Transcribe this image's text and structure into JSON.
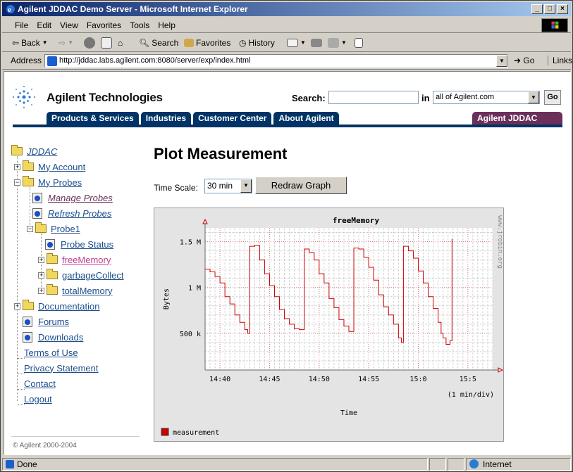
{
  "window": {
    "title": "Agilent JDDAC Demo Server - Microsoft Internet Explorer"
  },
  "menu": [
    "File",
    "Edit",
    "View",
    "Favorites",
    "Tools",
    "Help"
  ],
  "toolbar": {
    "back": "Back",
    "search": "Search",
    "favorites": "Favorites",
    "history": "History"
  },
  "address": {
    "label": "Address",
    "url": "http://jddac.labs.agilent.com:8080/server/exp/index.html",
    "go": "Go",
    "links": "Links"
  },
  "header": {
    "brand": "Agilent Technologies",
    "search_label": "Search:",
    "in_label": "in",
    "scope": "all of Agilent.com",
    "go": "Go",
    "tabs": [
      "Products & Services",
      "Industries",
      "Customer Center",
      "About Agilent"
    ],
    "home_tab": "Agilent JDDAC Home"
  },
  "sidebar": {
    "items": [
      {
        "label": "JDDAC"
      },
      {
        "label": "My Account"
      },
      {
        "label": "My Probes"
      },
      {
        "label": "Manage Probes"
      },
      {
        "label": "Refresh Probes"
      },
      {
        "label": "Probe1"
      },
      {
        "label": "Probe Status"
      },
      {
        "label": "freeMemory"
      },
      {
        "label": "garbageCollect"
      },
      {
        "label": "totalMemory"
      },
      {
        "label": "Documentation"
      },
      {
        "label": "Forums"
      },
      {
        "label": "Downloads"
      },
      {
        "label": "Terms of Use"
      },
      {
        "label": "Privacy Statement"
      },
      {
        "label": "Contact"
      },
      {
        "label": "Logout"
      }
    ],
    "copyright": "© Agilent 2000-2004"
  },
  "main": {
    "title": "Plot Measurement",
    "time_scale_label": "Time Scale:",
    "time_scale_value": "30 min",
    "redraw": "Redraw Graph"
  },
  "chart_data": {
    "type": "line",
    "title": "freeMemory",
    "xlabel": "Time",
    "ylabel": "Bytes",
    "x_note": "(1 min/div)",
    "watermark": "www.jrobin.org",
    "y_ticks": [
      "500 k",
      "1 M",
      "1.5 M"
    ],
    "x_ticks": [
      "14:40",
      "14:45",
      "14:50",
      "14:55",
      "15:0",
      "15:5"
    ],
    "xlim": [
      38.5,
      67.5
    ],
    "ylim": [
      100000,
      1650000
    ],
    "legend": "measurement",
    "color": "#cc0000",
    "series": [
      {
        "name": "measurement",
        "values": [
          [
            38.5,
            1200000
          ],
          [
            39,
            1170000
          ],
          [
            39.5,
            1120000
          ],
          [
            40,
            1050000
          ],
          [
            40.5,
            900000
          ],
          [
            41,
            820000
          ],
          [
            41.5,
            700000
          ],
          [
            42,
            620000
          ],
          [
            42.5,
            540000
          ],
          [
            42.8,
            500000
          ],
          [
            43,
            1450000
          ],
          [
            43.5,
            1460000
          ],
          [
            44,
            1300000
          ],
          [
            44.5,
            1150000
          ],
          [
            45,
            1020000
          ],
          [
            45.5,
            900000
          ],
          [
            46,
            760000
          ],
          [
            46.5,
            660000
          ],
          [
            47,
            600000
          ],
          [
            47.5,
            550000
          ],
          [
            48,
            540000
          ],
          [
            48.2,
            540000
          ],
          [
            48.5,
            1420000
          ],
          [
            49,
            1380000
          ],
          [
            49.5,
            1300000
          ],
          [
            50,
            1150000
          ],
          [
            50.5,
            1050000
          ],
          [
            51,
            880000
          ],
          [
            51.5,
            780000
          ],
          [
            52,
            650000
          ],
          [
            52.5,
            580000
          ],
          [
            53,
            520000
          ],
          [
            53.3,
            520000
          ],
          [
            53.5,
            1430000
          ],
          [
            54,
            1420000
          ],
          [
            54.5,
            1330000
          ],
          [
            55,
            1220000
          ],
          [
            55.5,
            1080000
          ],
          [
            56,
            920000
          ],
          [
            56.5,
            790000
          ],
          [
            57,
            700000
          ],
          [
            57.5,
            600000
          ],
          [
            58,
            450000
          ],
          [
            58.3,
            400000
          ],
          [
            58.5,
            1450000
          ],
          [
            59,
            1400000
          ],
          [
            59.5,
            1320000
          ],
          [
            60,
            1180000
          ],
          [
            60.5,
            1050000
          ],
          [
            61,
            900000
          ],
          [
            61.5,
            770000
          ],
          [
            62,
            620000
          ],
          [
            62.3,
            500000
          ],
          [
            62.5,
            450000
          ],
          [
            62.8,
            380000
          ],
          [
            63,
            380000
          ],
          [
            63.2,
            420000
          ],
          [
            63.4,
            1530000
          ]
        ]
      }
    ]
  }
}
